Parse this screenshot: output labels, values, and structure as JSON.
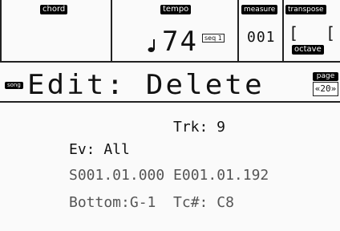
{
  "header": {
    "chord_label": "chord",
    "tempo_label": "tempo",
    "tempo_value": "74",
    "tempo_badge": "seq 1",
    "measure_label": "measure",
    "measure_value": "001",
    "transpose_label": "transpose",
    "transpose_left": "[",
    "transpose_right": "[",
    "octave_label": "octave",
    "note_icon": "quarter-note-icon"
  },
  "title_bar": {
    "mode_tag": "song",
    "title": "Edit: Delete",
    "page_label": "page",
    "page_value": "«20»"
  },
  "params": {
    "track": "Trk: 9",
    "event": "Ev: All",
    "range": "S001.01.000 E001.01.192",
    "bottom_tc": "Bottom:G-1  Tc#: C8"
  }
}
